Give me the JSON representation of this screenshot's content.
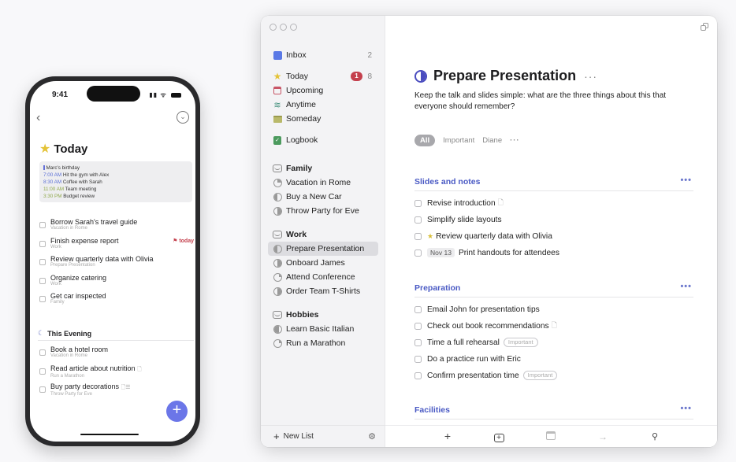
{
  "phone": {
    "status": {
      "time": "9:41",
      "signal": "signal-icon",
      "wifi": "wifi-icon",
      "battery": "battery-icon"
    },
    "back_icon": "‹",
    "more_icon": "⌄",
    "title": "Today",
    "calendar_events": [
      {
        "time": "",
        "text": "Marc's birthday",
        "color": "#6571d8"
      },
      {
        "time": "7:00 AM",
        "text": "Hit the gym with Alex",
        "color": "#5b6fd6"
      },
      {
        "time": "8:30 AM",
        "text": "Coffee with Sarah",
        "color": "#5b6fd6"
      },
      {
        "time": "11:00 AM",
        "text": "Team meeting",
        "color": "#8fa84a"
      },
      {
        "time": "3:30 PM",
        "text": "Budget review",
        "color": "#8fa84a"
      }
    ],
    "todos": [
      {
        "title": "Borrow Sarah's travel guide",
        "project": "Vacation in Rome"
      },
      {
        "title": "Finish expense report",
        "project": "Work",
        "flag": "today"
      },
      {
        "title": "Review quarterly data with Olivia",
        "project": "Prepare Presentation"
      },
      {
        "title": "Organize catering",
        "project": "Work"
      },
      {
        "title": "Get car inspected",
        "project": "Family"
      }
    ],
    "evening_heading": "This Evening",
    "evening_todos": [
      {
        "title": "Book a hotel room",
        "project": "Vacation in Rome"
      },
      {
        "title": "Read article about nutrition",
        "project": "Run a Marathon",
        "note": true
      },
      {
        "title": "Buy party decorations",
        "project": "Throw Party for Eve",
        "note": true,
        "checklist": true
      }
    ],
    "fab_label": "+"
  },
  "sidebar": {
    "inbox": {
      "label": "Inbox",
      "count": "2"
    },
    "today": {
      "label": "Today",
      "badge": "1",
      "count": "8"
    },
    "upcoming": {
      "label": "Upcoming"
    },
    "anytime": {
      "label": "Anytime"
    },
    "someday": {
      "label": "Someday"
    },
    "logbook": {
      "label": "Logbook"
    },
    "areas": [
      {
        "name": "Family",
        "projects": [
          "Vacation in Rome",
          "Buy a New Car",
          "Throw Party for Eve"
        ]
      },
      {
        "name": "Work",
        "projects": [
          "Prepare Presentation",
          "Onboard James",
          "Attend Conference",
          "Order Team T-Shirts"
        ]
      },
      {
        "name": "Hobbies",
        "projects": [
          "Learn Basic Italian",
          "Run a Marathon"
        ]
      }
    ],
    "selected_project": "Prepare Presentation",
    "new_list_label": "New List"
  },
  "project": {
    "title": "Prepare Presentation",
    "more": "···",
    "notes": "Keep the talk and slides simple: what are the three things about this that everyone should remember?",
    "filters": [
      "All",
      "Important",
      "Diane"
    ],
    "filter_more": "···",
    "headings": [
      {
        "title": "Slides and notes",
        "todos": [
          {
            "title": "Revise introduction",
            "note": true
          },
          {
            "title": "Simplify slide layouts"
          },
          {
            "title": "Review quarterly data with Olivia",
            "starred": true
          },
          {
            "title": "Print handouts for attendees",
            "date": "Nov 13"
          }
        ]
      },
      {
        "title": "Preparation",
        "todos": [
          {
            "title": "Email John for presentation tips"
          },
          {
            "title": "Check out book recommendations",
            "note": true
          },
          {
            "title": "Time a full rehearsal",
            "tag": "Important"
          },
          {
            "title": "Do a practice run with Eric"
          },
          {
            "title": "Confirm presentation time",
            "tag": "Important"
          }
        ]
      },
      {
        "title": "Facilities",
        "todos": []
      }
    ],
    "heading_more": "•••"
  },
  "toolbar": {
    "buttons": [
      "new-todo",
      "new-heading",
      "when",
      "move",
      "search"
    ]
  },
  "colors": {
    "accent": "#4a5ac4",
    "badge": "#c4404d",
    "today_star": "#e4c338",
    "fab": "#6b76e8"
  }
}
